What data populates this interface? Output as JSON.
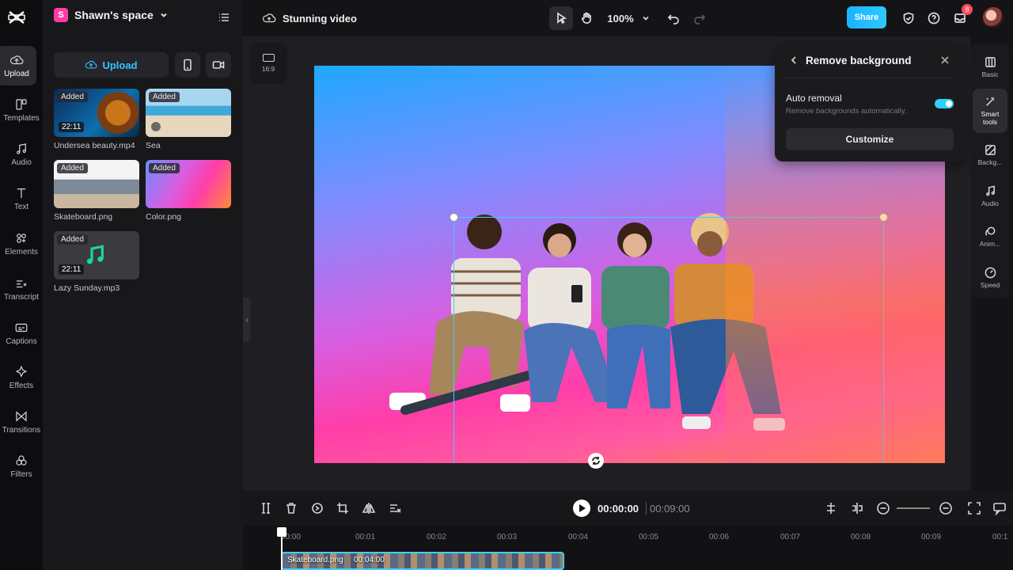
{
  "rail": {
    "items": [
      {
        "label": "Upload",
        "icon": "upload-cloud-icon"
      },
      {
        "label": "Templates",
        "icon": "templates-icon"
      },
      {
        "label": "Audio",
        "icon": "music-note-icon"
      },
      {
        "label": "Text",
        "icon": "text-icon"
      },
      {
        "label": "Elements",
        "icon": "elements-icon"
      },
      {
        "label": "Transcript",
        "icon": "transcript-icon"
      },
      {
        "label": "Captions",
        "icon": "captions-icon"
      },
      {
        "label": "Effects",
        "icon": "effects-icon"
      },
      {
        "label": "Transitions",
        "icon": "transitions-icon"
      },
      {
        "label": "Filters",
        "icon": "filters-icon"
      }
    ]
  },
  "panel": {
    "space_badge": "S",
    "space_name": "Shawn's space",
    "upload_label": "Upload",
    "media": [
      {
        "name": "Undersea beauty.mp4",
        "status": "Added",
        "duration": "22:11"
      },
      {
        "name": "Sea",
        "status": "Added",
        "duration": ""
      },
      {
        "name": "Skateboard.png",
        "status": "Added",
        "duration": ""
      },
      {
        "name": "Color.png",
        "status": "Added",
        "duration": ""
      },
      {
        "name": "Lazy Sunday.mp3",
        "status": "Added",
        "duration": "22:11"
      }
    ]
  },
  "topbar": {
    "project_title": "Stunning video",
    "zoom": "100%",
    "share_label": "Share",
    "notification_count": "8"
  },
  "stage": {
    "aspect_ratio": "16:9"
  },
  "remove_bg": {
    "title": "Remove background",
    "auto_title": "Auto removal",
    "auto_desc": "Remove backgrounds automatically.",
    "auto_enabled": true,
    "customize_label": "Customize"
  },
  "right_tools": [
    {
      "label": "Basic",
      "icon": "basic-icon"
    },
    {
      "label": "Smart tools",
      "icon": "magic-wand-icon"
    },
    {
      "label": "Backg...",
      "icon": "background-icon"
    },
    {
      "label": "Audio",
      "icon": "music-note-icon"
    },
    {
      "label": "Anim...",
      "icon": "animation-icon"
    },
    {
      "label": "Speed",
      "icon": "speed-icon"
    }
  ],
  "timeline": {
    "current_time": "00:00:00",
    "total_time": "00:09:00",
    "ruler": [
      "00:00",
      "00:01",
      "00:02",
      "00:03",
      "00:04",
      "00:05",
      "00:06",
      "00:07",
      "00:08",
      "00:09",
      "00:1"
    ],
    "clip_name": "Skateboard.png",
    "clip_duration": "00:04:00"
  }
}
